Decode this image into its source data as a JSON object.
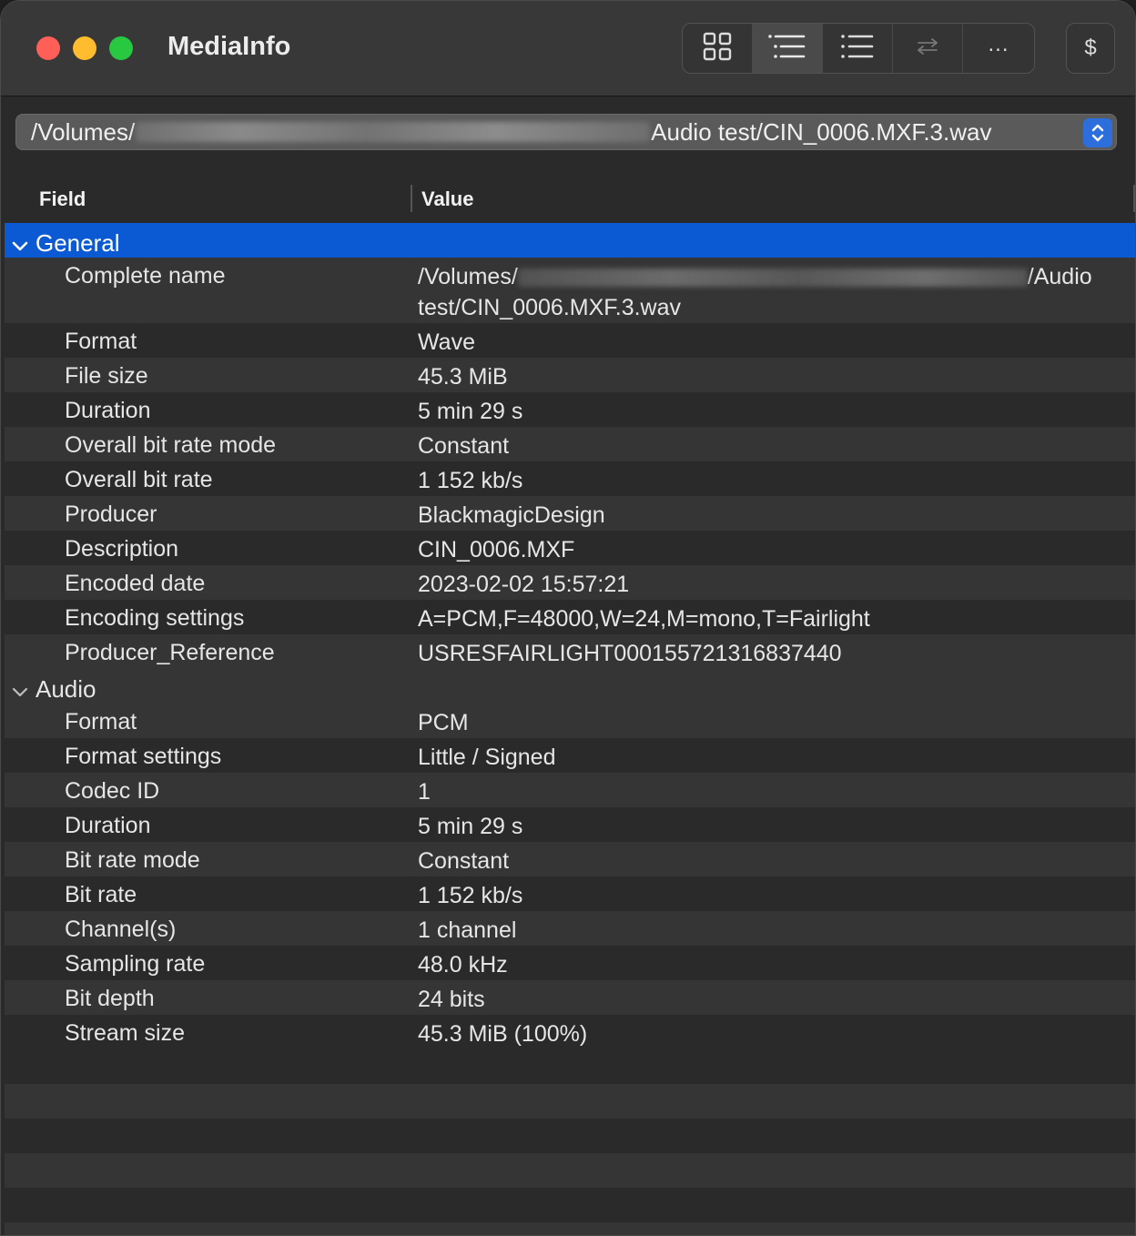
{
  "window": {
    "title": "MediaInfo"
  },
  "toolbar": {
    "buttons": [
      {
        "icon": "grid-view-icon",
        "state": "normal"
      },
      {
        "icon": "tree-view-icon",
        "state": "selected"
      },
      {
        "icon": "list-view-icon",
        "state": "normal"
      },
      {
        "icon": "compare-arrows-icon",
        "state": "disabled"
      },
      {
        "label": "..."
      }
    ],
    "dollar_label": "$"
  },
  "path_popup": {
    "prefix": "/Volumes/",
    "suffix": "Audio test/CIN_0006.MXF.3.wav"
  },
  "table": {
    "header_field": "Field",
    "header_value": "Value",
    "general_label": "General",
    "complete_name_field": "Complete name",
    "complete_name_prefix": "/Volumes/",
    "complete_name_suffix": "/Audio",
    "complete_name_line2": "test/CIN_0006.MXF.3.wav",
    "general_rows": [
      {
        "field": "Format",
        "value": "Wave"
      },
      {
        "field": "File size",
        "value": "45.3 MiB"
      },
      {
        "field": "Duration",
        "value": "5 min 29 s"
      },
      {
        "field": "Overall bit rate mode",
        "value": "Constant"
      },
      {
        "field": "Overall bit rate",
        "value": "1 152 kb/s"
      },
      {
        "field": "Producer",
        "value": "BlackmagicDesign"
      },
      {
        "field": "Description",
        "value": "CIN_0006.MXF"
      },
      {
        "field": "Encoded date",
        "value": "2023-02-02 15:57:21"
      },
      {
        "field": "Encoding settings",
        "value": "A=PCM,F=48000,W=24,M=mono,T=Fairlight"
      },
      {
        "field": "Producer_Reference",
        "value": "USRESFAIRLIGHT000155721316837440"
      }
    ],
    "audio_label": "Audio",
    "audio_rows": [
      {
        "field": "Format",
        "value": "PCM"
      },
      {
        "field": "Format settings",
        "value": "Little / Signed"
      },
      {
        "field": "Codec ID",
        "value": "1"
      },
      {
        "field": "Duration",
        "value": "5 min 29 s"
      },
      {
        "field": "Bit rate mode",
        "value": "Constant"
      },
      {
        "field": "Bit rate",
        "value": "1 152 kb/s"
      },
      {
        "field": "Channel(s)",
        "value": "1 channel"
      },
      {
        "field": "Sampling rate",
        "value": "48.0 kHz"
      },
      {
        "field": "Bit depth",
        "value": "24 bits"
      },
      {
        "field": "Stream size",
        "value": "45.3 MiB (100%)"
      }
    ]
  }
}
